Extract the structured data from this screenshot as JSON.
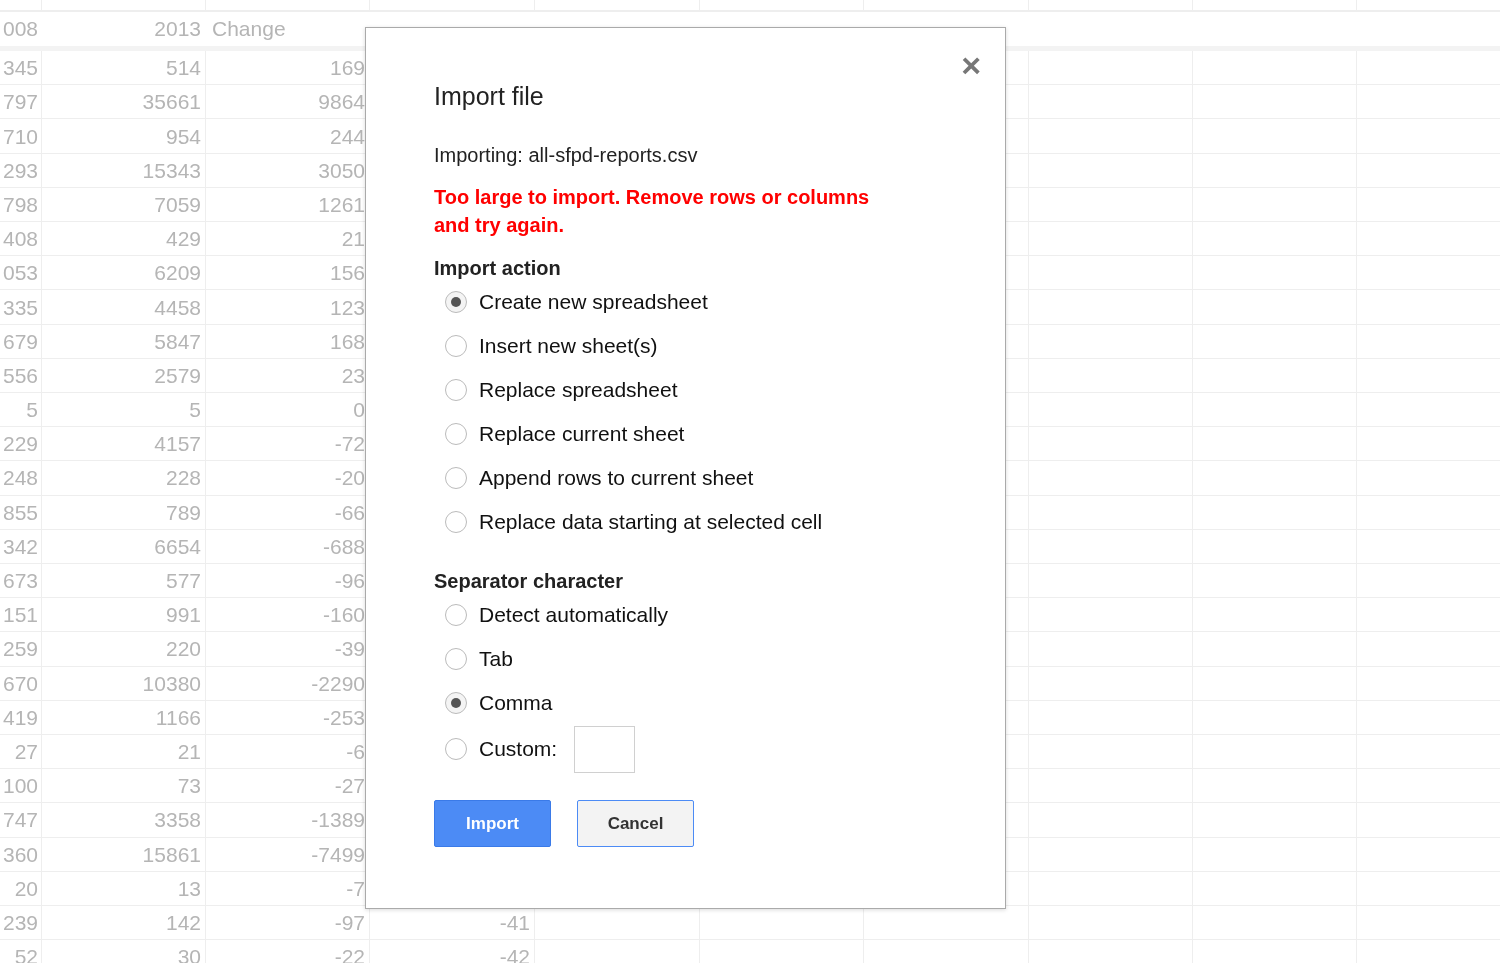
{
  "sheet": {
    "header": [
      "008",
      "2013",
      "Change"
    ],
    "rows": [
      [
        "345",
        "514",
        "169"
      ],
      [
        "797",
        "35661",
        "9864"
      ],
      [
        "710",
        "954",
        "244"
      ],
      [
        "293",
        "15343",
        "3050"
      ],
      [
        "798",
        "7059",
        "1261"
      ],
      [
        "408",
        "429",
        "21"
      ],
      [
        "053",
        "6209",
        "156"
      ],
      [
        "335",
        "4458",
        "123"
      ],
      [
        "679",
        "5847",
        "168"
      ],
      [
        "556",
        "2579",
        "23"
      ],
      [
        "5",
        "5",
        "0"
      ],
      [
        "229",
        "4157",
        "-72"
      ],
      [
        "248",
        "228",
        "-20"
      ],
      [
        "855",
        "789",
        "-66"
      ],
      [
        "342",
        "6654",
        "-688"
      ],
      [
        "673",
        "577",
        "-96"
      ],
      [
        "151",
        "991",
        "-160"
      ],
      [
        "259",
        "220",
        "-39"
      ],
      [
        "670",
        "10380",
        "-2290"
      ],
      [
        "419",
        "1166",
        "-253"
      ],
      [
        "27",
        "21",
        "-6"
      ],
      [
        "100",
        "73",
        "-27"
      ],
      [
        "747",
        "3358",
        "-1389"
      ],
      [
        "360",
        "15861",
        "-7499"
      ],
      [
        "20",
        "13",
        "-7"
      ],
      [
        "239",
        "142",
        "-97",
        "-41"
      ],
      [
        "52",
        "30",
        "-22",
        "-42"
      ]
    ]
  },
  "dialog": {
    "title": "Import file",
    "close": "×",
    "importing": "Importing: all-sfpd-reports.csv",
    "error": "Too large to import. Remove rows or columns and try again.",
    "sections": [
      {
        "heading": "Import action",
        "options": [
          {
            "label": "Create new spreadsheet",
            "selected": true
          },
          {
            "label": "Insert new sheet(s)",
            "selected": false
          },
          {
            "label": "Replace spreadsheet",
            "selected": false
          },
          {
            "label": "Replace current sheet",
            "selected": false
          },
          {
            "label": "Append rows to current sheet",
            "selected": false
          },
          {
            "label": "Replace data starting at selected cell",
            "selected": false
          }
        ]
      },
      {
        "heading": "Separator character",
        "options": [
          {
            "label": "Detect automatically",
            "selected": false
          },
          {
            "label": "Tab",
            "selected": false
          },
          {
            "label": "Comma",
            "selected": true
          },
          {
            "label": "Custom:",
            "selected": false,
            "kind": "custom"
          }
        ]
      }
    ],
    "buttons": [
      {
        "label": "Import",
        "kind": "primary"
      },
      {
        "label": "Cancel",
        "kind": "secondary"
      }
    ]
  }
}
